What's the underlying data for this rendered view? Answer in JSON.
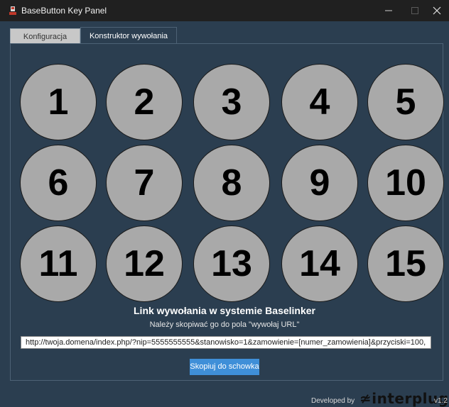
{
  "window": {
    "title": "BaseButton Key Panel"
  },
  "tabs": [
    {
      "label": "Konfiguracja",
      "active": false
    },
    {
      "label": "Konstruktor wywołania",
      "active": true
    }
  ],
  "buttons": [
    "1",
    "2",
    "3",
    "4",
    "5",
    "6",
    "7",
    "8",
    "9",
    "10",
    "11",
    "12",
    "13",
    "14",
    "15"
  ],
  "section": {
    "heading": "Link wywołania w systemie Baselinker",
    "subheading": "Należy skopiwać go do pola \"wywołaj URL\""
  },
  "url_field": {
    "value": "http://twoja.domena/index.php/?nip=5555555555&stanowisko=1&zamowienie=[numer_zamowienia]&przyciski=100,"
  },
  "copy_button": {
    "label": "Skopiuj do schowka"
  },
  "footer": {
    "developed_by": "Developed by",
    "logo": "interplug",
    "version": "v1.2"
  },
  "colors": {
    "background": "#2b3e50",
    "button_fill": "#a9a9a9",
    "accent": "#3f8fd8",
    "titlebar": "#202020"
  }
}
